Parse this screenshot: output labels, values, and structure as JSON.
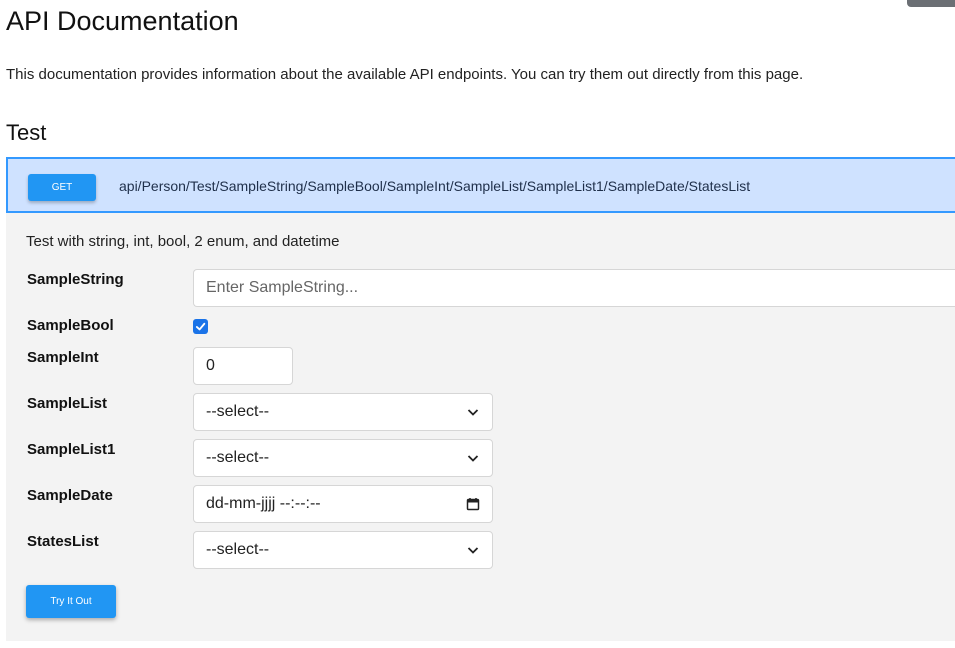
{
  "page": {
    "title": "API Documentation",
    "intro": "This documentation provides information about the available API endpoints. You can try them out directly from this page."
  },
  "section": {
    "title": "Test",
    "method": "GET",
    "path": "api/Person/Test/SampleString/SampleBool/SampleInt/SampleList/SampleList1/SampleDate/StatesList",
    "description": "Test with string, int, bool, 2 enum, and datetime"
  },
  "form": {
    "sample_string": {
      "label": "SampleString",
      "placeholder": "Enter SampleString...",
      "value": ""
    },
    "sample_bool": {
      "label": "SampleBool",
      "checked": true
    },
    "sample_int": {
      "label": "SampleInt",
      "value": "0"
    },
    "sample_list": {
      "label": "SampleList",
      "selected": "--select--"
    },
    "sample_list1": {
      "label": "SampleList1",
      "selected": "--select--"
    },
    "sample_date": {
      "label": "SampleDate",
      "value": "dd-mm-jjjj --:--:--"
    },
    "states_list": {
      "label": "StatesList",
      "selected": "--select--"
    },
    "submit_label": "Try It Out"
  },
  "colors": {
    "accent": "#2196f3",
    "endpoint_bg": "#cfe2ff",
    "endpoint_border": "#3399ff",
    "panel_bg": "#f3f3f3"
  },
  "icons": [
    "chevron-down-icon",
    "calendar-icon",
    "checkmark-icon"
  ]
}
